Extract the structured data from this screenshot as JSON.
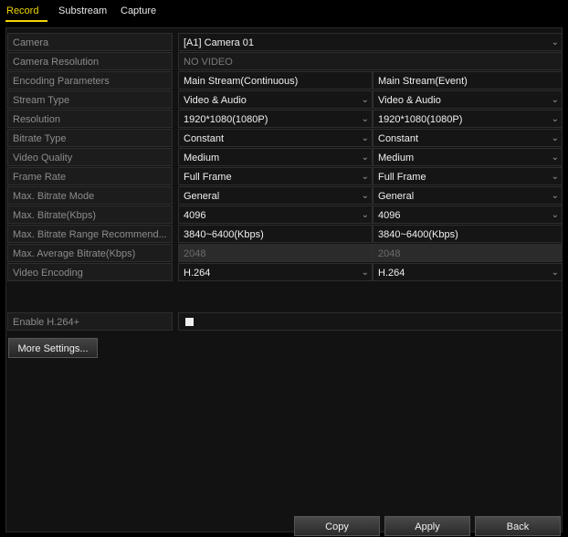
{
  "tabs": [
    {
      "label": "Record"
    },
    {
      "label": "Substream"
    },
    {
      "label": "Capture"
    }
  ],
  "form": {
    "camera": {
      "label": "Camera",
      "value": "[A1] Camera 01"
    },
    "camera_resolution": {
      "label": "Camera Resolution",
      "value": "NO VIDEO"
    },
    "encoding_parameters": {
      "label": "Encoding Parameters",
      "col1": "Main Stream(Continuous)",
      "col2": "Main Stream(Event)"
    },
    "rows": [
      {
        "label": "Stream Type",
        "col1": "Video & Audio",
        "col2": "Video & Audio"
      },
      {
        "label": "Resolution",
        "col1": "1920*1080(1080P)",
        "col2": "1920*1080(1080P)"
      },
      {
        "label": "Bitrate Type",
        "col1": "Constant",
        "col2": "Constant"
      },
      {
        "label": "Video Quality",
        "col1": "Medium",
        "col2": "Medium"
      },
      {
        "label": "Frame Rate",
        "col1": "Full Frame",
        "col2": "Full Frame"
      },
      {
        "label": "Max. Bitrate Mode",
        "col1": "General",
        "col2": "General"
      },
      {
        "label": "Max. Bitrate(Kbps)",
        "col1": "4096",
        "col2": "4096"
      }
    ],
    "range_recommend": {
      "label": "Max. Bitrate Range Recommend...",
      "col1": "3840~6400(Kbps)",
      "col2": "3840~6400(Kbps)"
    },
    "avg_bitrate": {
      "label": "Max. Average Bitrate(Kbps)",
      "col1": "2048",
      "col2": "2048"
    },
    "video_encoding": {
      "label": "Video Encoding",
      "col1": "H.264",
      "col2": "H.264"
    },
    "enable_h264plus": {
      "label": "Enable H.264+",
      "checked": true
    }
  },
  "buttons": {
    "more_settings": "More Settings...",
    "copy": "Copy",
    "apply": "Apply",
    "back": "Back"
  },
  "icons": {
    "dropdown": "chevron-down-icon"
  },
  "colors": {
    "active_tab": "#f3d600",
    "background": "#000000"
  }
}
